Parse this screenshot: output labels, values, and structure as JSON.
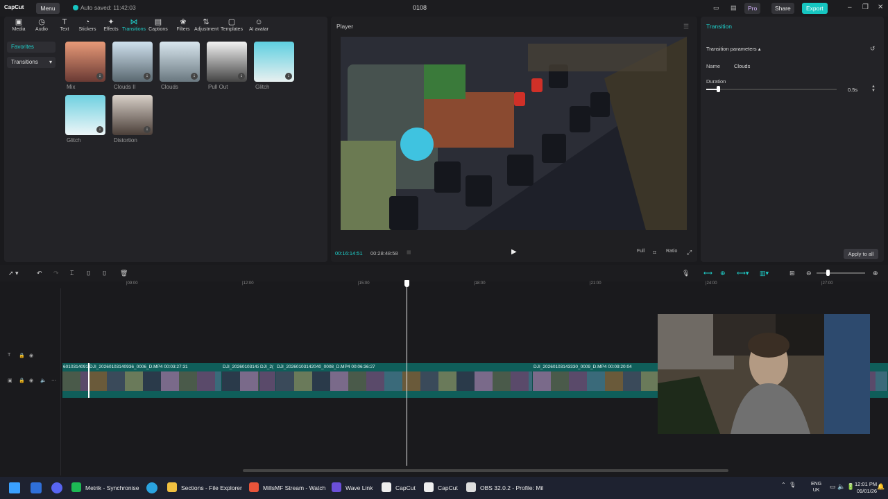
{
  "titlebar": {
    "logo": "CapCut",
    "menu": "Menu",
    "autosave": "Auto saved: 11:42:03",
    "project": "0108",
    "pro": "Pro",
    "share": "Share",
    "export": "Export"
  },
  "tools": [
    {
      "label": "Media",
      "icon": "▣"
    },
    {
      "label": "Audio",
      "icon": "◷"
    },
    {
      "label": "Text",
      "icon": "T"
    },
    {
      "label": "Stickers",
      "icon": "◔"
    },
    {
      "label": "Effects",
      "icon": "✦"
    },
    {
      "label": "Transitions",
      "icon": "⋈"
    },
    {
      "label": "Captions",
      "icon": "▤"
    },
    {
      "label": "Filters",
      "icon": "❀"
    },
    {
      "label": "Adjustment",
      "icon": "⇅"
    },
    {
      "label": "Templates",
      "icon": "▢"
    },
    {
      "label": "AI avatar",
      "icon": "☺"
    }
  ],
  "nav": {
    "favorites": "Favorites",
    "transitions": "Transitions"
  },
  "transitions": [
    "Mix",
    "Clouds II",
    "Clouds",
    "Pull Out",
    "Glitch",
    "Glitch",
    "Distortion"
  ],
  "player": {
    "title": "Player",
    "current": "00:16:14:51",
    "total": "00:28:48:58",
    "full": "Full",
    "ratio": "Ratio"
  },
  "right": {
    "tab": "Transition",
    "params": "Transition parameters ▴",
    "name_label": "Name",
    "name_value": "Clouds",
    "duration_label": "Duration",
    "duration_value": "0.5s",
    "duration_fraction": 0.09,
    "apply": "Apply to all"
  },
  "ruler": [
    "|09:00",
    "|12:00",
    "|15:00",
    "|18:00",
    "|21:00",
    "|24:00",
    "|27:00"
  ],
  "clips": [
    {
      "label": "6010314091"
    },
    {
      "label": "DJI_20260103140936_0006_D.MP4   00:03:27:31"
    },
    {
      "label": "DJI_20260103143"
    },
    {
      "label": "DJI_2("
    },
    {
      "label": "DJI_20260103142040_0008_D.MP4   00:06:36:27"
    },
    {
      "label": "DJI_20260103143330_0009_D.MP4   00:09:20:04"
    }
  ],
  "taskbar": [
    {
      "label": "Metrik - Synchronise",
      "color": "#1db954"
    },
    {
      "label": "Sections - File Explorer",
      "color": "#f0c040"
    },
    {
      "label": "MillsMF Stream - Watch",
      "color": "#e8543a"
    },
    {
      "label": "Wave Link",
      "color": "#6b4fd8"
    },
    {
      "label": "CapCut",
      "color": "#eeeeee"
    },
    {
      "label": "CapCut",
      "color": "#eeeeee"
    },
    {
      "label": "OBS 32.0.2 - Profile: Mil",
      "color": "#dddddd"
    }
  ],
  "tray": {
    "lang1": "ENG",
    "lang2": "UK",
    "time": "12:01 PM",
    "date": "09/01/26"
  }
}
